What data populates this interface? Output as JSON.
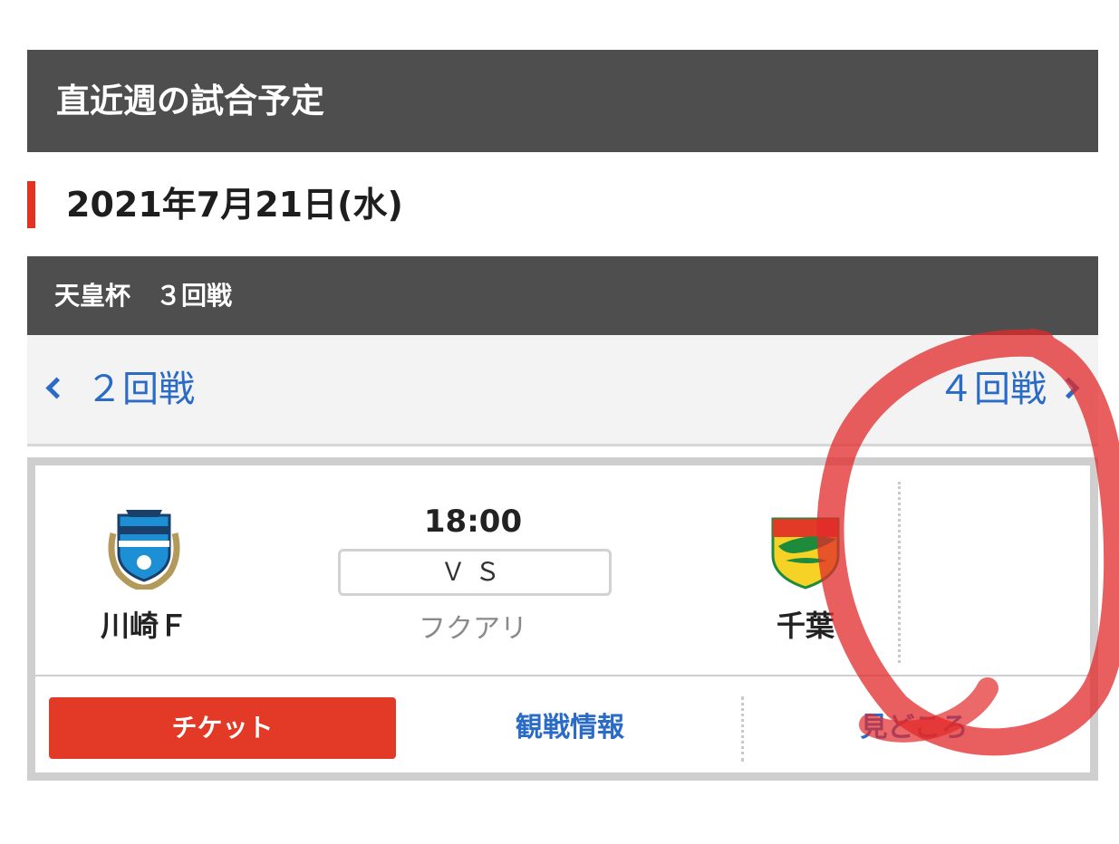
{
  "header": {
    "title": "直近週の試合予定"
  },
  "date": {
    "label": "2021年7月21日(水)"
  },
  "competition": {
    "label": "天皇杯　３回戦"
  },
  "round_nav": {
    "prev_label": "２回戦",
    "next_label": "４回戦"
  },
  "match": {
    "home_team": "川崎Ｆ",
    "away_team": "千葉",
    "kickoff": "18:00",
    "vs": "ＶＳ",
    "venue": "フクアリ"
  },
  "actions": {
    "ticket": "チケット",
    "info": "観戦情報",
    "highlights": "見どころ"
  },
  "colors": {
    "header_bg": "#4e4e4e",
    "accent_red": "#e23222",
    "link_blue": "#2a6bc7",
    "ticket_red": "#e23a26",
    "annotation_red": "#e22a2a"
  },
  "icons": {
    "home_logo": "kawasaki-frontale-crest-icon",
    "away_logo": "jef-united-chiba-crest-icon",
    "prev": "chevron-left-icon",
    "next": "chevron-right-icon"
  }
}
